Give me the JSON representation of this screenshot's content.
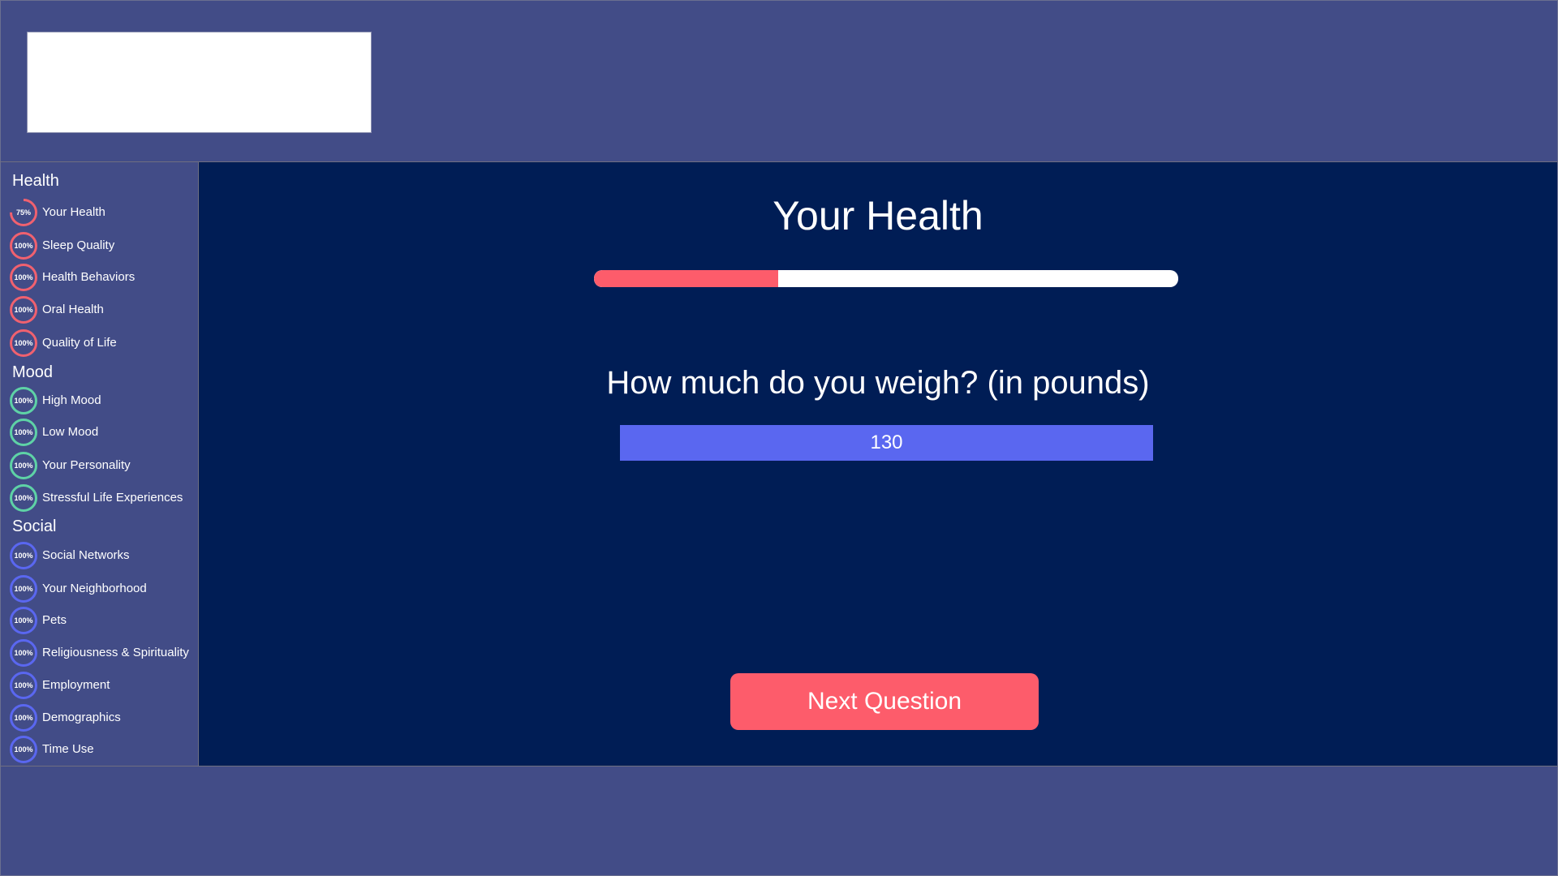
{
  "colors": {
    "header_bg": "#424c87",
    "main_bg": "#001d55",
    "accent": "#fd5c6b",
    "health_ring": "#f0616f",
    "mood_ring": "#5ed2a6",
    "social_ring": "#5a67f0",
    "input_bg": "#5a67f0"
  },
  "sidebar": {
    "sections": [
      {
        "title": "Health",
        "ring_color": "#f0616f",
        "items": [
          {
            "label": "Your Health",
            "percent": "75%",
            "progress": 0.75
          },
          {
            "label": "Sleep Quality",
            "percent": "100%",
            "progress": 1
          },
          {
            "label": "Health Behaviors",
            "percent": "100%",
            "progress": 1
          },
          {
            "label": "Oral Health",
            "percent": "100%",
            "progress": 1
          },
          {
            "label": "Quality of Life",
            "percent": "100%",
            "progress": 1
          }
        ]
      },
      {
        "title": "Mood",
        "ring_color": "#5ed2a6",
        "items": [
          {
            "label": "High Mood",
            "percent": "100%",
            "progress": 1
          },
          {
            "label": "Low Mood",
            "percent": "100%",
            "progress": 1
          },
          {
            "label": "Your Personality",
            "percent": "100%",
            "progress": 1
          },
          {
            "label": "Stressful Life Experiences",
            "percent": "100%",
            "progress": 1
          }
        ]
      },
      {
        "title": "Social",
        "ring_color": "#5a67f0",
        "items": [
          {
            "label": "Social Networks",
            "percent": "100%",
            "progress": 1
          },
          {
            "label": "Your Neighborhood",
            "percent": "100%",
            "progress": 1
          },
          {
            "label": "Pets",
            "percent": "100%",
            "progress": 1
          },
          {
            "label": "Religiousness & Spirituality",
            "percent": "100%",
            "progress": 1
          },
          {
            "label": "Employment",
            "percent": "100%",
            "progress": 1
          },
          {
            "label": "Demographics",
            "percent": "100%",
            "progress": 1
          },
          {
            "label": "Time Use",
            "percent": "100%",
            "progress": 1
          }
        ]
      }
    ]
  },
  "main": {
    "title": "Your Health",
    "progress": 0.315,
    "question": "How much do you weigh? (in pounds)",
    "answer_value": "130",
    "next_label": "Next Question"
  }
}
